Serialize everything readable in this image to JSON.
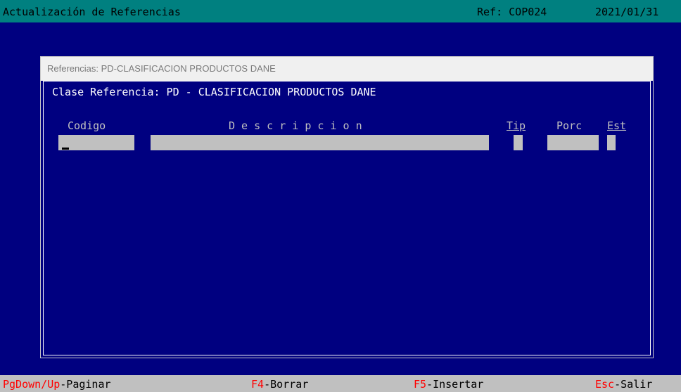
{
  "header": {
    "title": "Actualización de Referencias",
    "ref": "Ref: COP024",
    "date": "2021/01/31"
  },
  "dialog": {
    "title": "Referencias: PD-CLASIFICACION PRODUCTOS DANE",
    "clase_line": "Clase Referencia: PD - CLASIFICACION PRODUCTOS DANE",
    "columns": {
      "codigo": "Codigo",
      "descripcion": "D e s c r i p c i o n",
      "tip": "Tip",
      "porc": "Porc",
      "est": "Est"
    },
    "fields": {
      "codigo": "",
      "descripcion": "",
      "tip": "",
      "porc": "",
      "est": ""
    }
  },
  "footer": {
    "pgdown_key": "PgDown/Up",
    "pgdown_desc": "-Paginar",
    "f4_key": "F4",
    "f4_desc": "-Borrar",
    "f5_key": "F5",
    "f5_desc": "-Insertar",
    "esc_key": "Esc",
    "esc_desc": "-Salir"
  },
  "colors": {
    "background": "#000080",
    "topbar": "#008080",
    "field": "#c0c0c0",
    "hotkey": "#ff0000"
  }
}
